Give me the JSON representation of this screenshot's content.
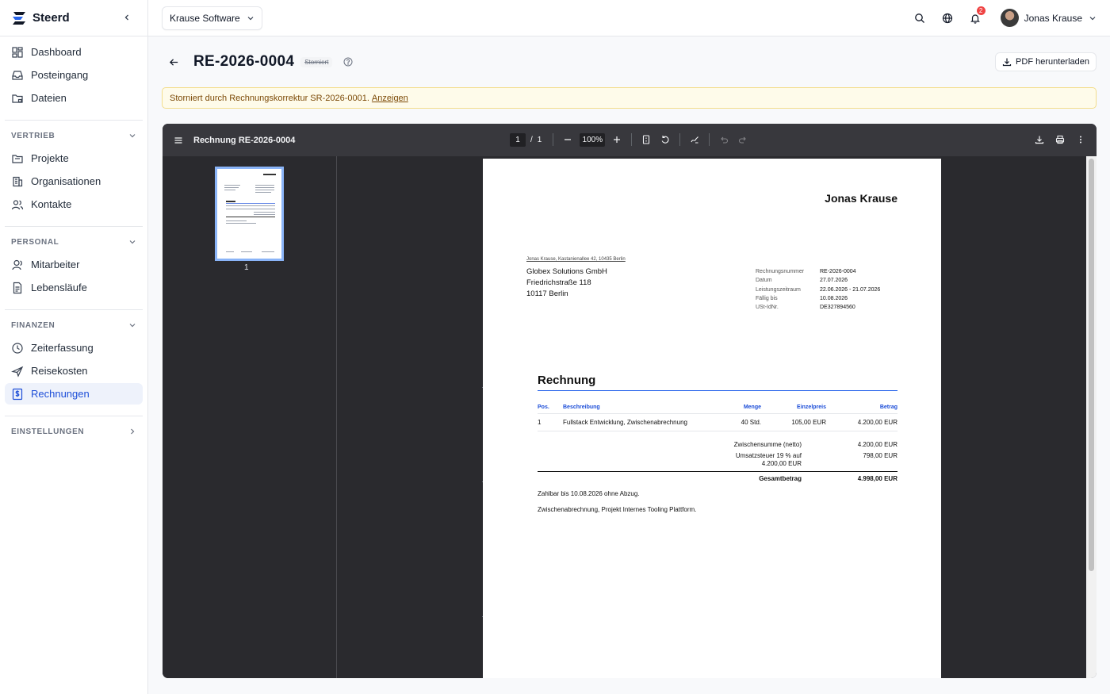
{
  "brand": {
    "name": "Steerd"
  },
  "nav": {
    "top": [
      {
        "label": "Dashboard"
      },
      {
        "label": "Posteingang"
      },
      {
        "label": "Dateien"
      }
    ],
    "sections": {
      "vertrieb": {
        "label": "VERTRIEB",
        "items": [
          {
            "label": "Projekte"
          },
          {
            "label": "Organisationen"
          },
          {
            "label": "Kontakte"
          }
        ]
      },
      "personal": {
        "label": "PERSONAL",
        "items": [
          {
            "label": "Mitarbeiter"
          },
          {
            "label": "Lebensläufe"
          }
        ]
      },
      "finanzen": {
        "label": "FINANZEN",
        "items": [
          {
            "label": "Zeiterfassung"
          },
          {
            "label": "Reisekosten"
          },
          {
            "label": "Rechnungen"
          }
        ]
      },
      "einstellungen": {
        "label": "EINSTELLUNGEN"
      }
    }
  },
  "topbar": {
    "company": "Krause Software",
    "notifications": "2",
    "user_name": "Jonas Krause"
  },
  "page": {
    "title": "RE-2026-0004",
    "status": "Storniert",
    "pdf_button": "PDF herunterladen",
    "alert_text": "Storniert durch Rechnungskorrektur SR-2026-0001.",
    "alert_link": "Anzeigen"
  },
  "viewer": {
    "title": "Rechnung RE-2026-0004",
    "page_current": "1",
    "page_sep": "/",
    "page_total": "1",
    "zoom": "100%",
    "thumb_label": "1"
  },
  "invoice": {
    "sender_name": "Jonas Krause",
    "return_address": "Jonas Krause, Kastanienallee 42, 10435 Berlin",
    "recipient": [
      "Globex Solutions GmbH",
      "Friedrichstraße 118",
      "10117 Berlin"
    ],
    "meta": [
      {
        "label": "Rechnungsnummer",
        "value": "RE-2026-0004"
      },
      {
        "label": "Datum",
        "value": "27.07.2026"
      },
      {
        "label": "Leistungszeitraum",
        "value": "22.06.2026 - 21.07.2026"
      },
      {
        "label": "Fällig bis",
        "value": "10.08.2026"
      },
      {
        "label": "USt-IdNr.",
        "value": "DE327894560"
      }
    ],
    "heading": "Rechnung",
    "columns": {
      "pos": "Pos.",
      "desc": "Beschreibung",
      "qty": "Menge",
      "unit": "Einzelpreis",
      "amount": "Betrag"
    },
    "rows": [
      {
        "pos": "1",
        "desc": "Fullstack Entwicklung, Zwischenabrechnung",
        "qty": "40 Std.",
        "unit": "105,00 EUR",
        "amount": "4.200,00 EUR"
      }
    ],
    "subtotal_label": "Zwischensumme (netto)",
    "subtotal_value": "4.200,00 EUR",
    "tax_label_1": "Umsatzsteuer 19 % auf",
    "tax_label_2": "4.200,00 EUR",
    "tax_value": "798,00 EUR",
    "total_label": "Gesamtbetrag",
    "total_value": "4.998,00 EUR",
    "note_payment": "Zahlbar bis 10.08.2026 ohne Abzug.",
    "note_project": "Zwischenabrechnung, Projekt Internes Tooling Plattform."
  },
  "colors": {
    "accent": "#1d4ed8",
    "active_bg": "#eef2fb",
    "alert_bg": "#fefbea",
    "viewer_bg": "#2a2a2e",
    "toolbar_bg": "#38383d"
  }
}
